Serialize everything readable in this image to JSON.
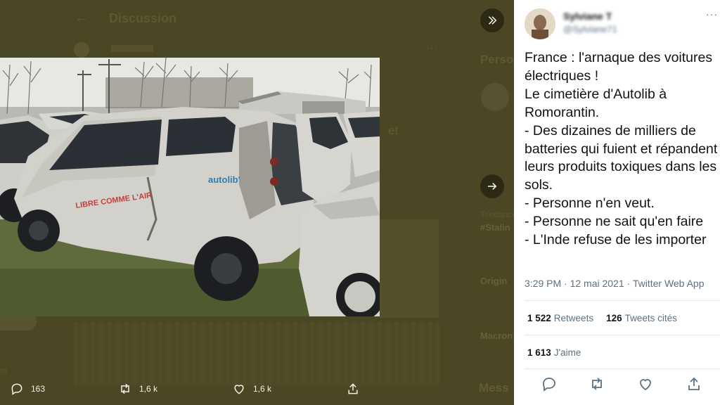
{
  "background": {
    "title": "Discussion",
    "right_title": "Perso",
    "partial_text": "et",
    "trends_label": "Tendance",
    "trend_1": "#Stalin",
    "trend_2": "Origin",
    "trend_3": "Macron",
    "left_partial": "ot",
    "messages_title": "Mess"
  },
  "media_actions": {
    "reply_count": "163",
    "retweet_count": "1,6 k",
    "like_count": "1,6 k"
  },
  "photo_text": {
    "brand": "autolib'",
    "slogan": "LIBRE COMME L'AIR"
  },
  "tweet": {
    "author_name": "Sylviane T",
    "author_handle": "@Sylviane71",
    "text": "France : l'arnaque des voitures électriques !\nLe cimetière d'Autolib à Romorantin.\n- Des dizaines de milliers de batteries qui fuient et répandent leurs produits toxiques dans les sols.\n- Personne n'en veut.\n- Personne ne sait qu'en faire\n- L'Inde refuse de les importer",
    "timestamp": "3:29 PM · 12 mai 2021 · Twitter Web App",
    "retweets_count": "1 522",
    "retweets_label": "Retweets",
    "quotes_count": "126",
    "quotes_label": "Tweets cités",
    "likes_count": "1 613",
    "likes_label": "J'aime"
  },
  "icons": [
    "back-arrow-icon",
    "collapse-icon",
    "next-arrow-icon",
    "reply-icon",
    "retweet-icon",
    "like-icon",
    "share-icon",
    "more-icon"
  ]
}
